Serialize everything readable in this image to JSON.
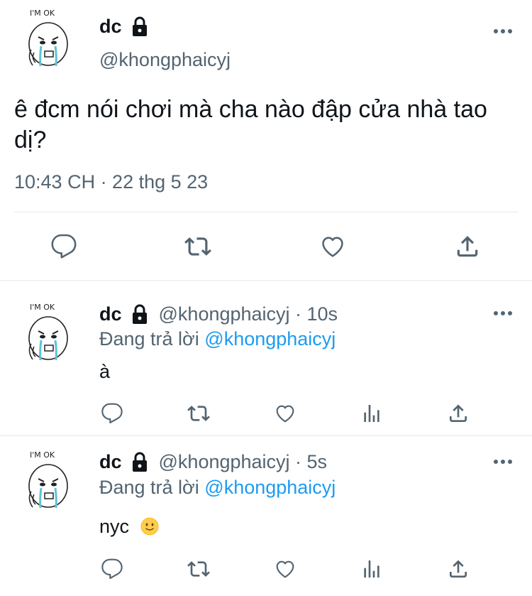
{
  "main_tweet": {
    "avatar_caption": "I'M OK",
    "display_name": "dc",
    "handle": "@khongphaicyj",
    "text": "ê đcm nói chơi mà cha nào đập cửa nhà tao dị?",
    "meta": "10:43 CH · 22 thg 5 23"
  },
  "replies": [
    {
      "avatar_caption": "I'M OK",
      "display_name": "dc",
      "handle_time": "@khongphaicyj · 10s",
      "replying_prefix": "Đang trả lời",
      "replying_to": "@khongphaicyj",
      "text": "à"
    },
    {
      "avatar_caption": "I'M OK",
      "display_name": "dc",
      "handle_time": "@khongphaicyj · 5s",
      "replying_prefix": "Đang trả lời",
      "replying_to": "@khongphaicyj",
      "text": "nyc",
      "emoji": "slightly-smiling-face"
    }
  ],
  "icons": [
    "lock-icon",
    "more-icon",
    "reply-icon",
    "retweet-icon",
    "like-icon",
    "share-icon",
    "analytics-icon"
  ],
  "colors": {
    "text": "#0f1419",
    "secondary": "#536471",
    "link": "#1d9bf0",
    "icon": "#536471",
    "divider": "#eff3f4"
  }
}
